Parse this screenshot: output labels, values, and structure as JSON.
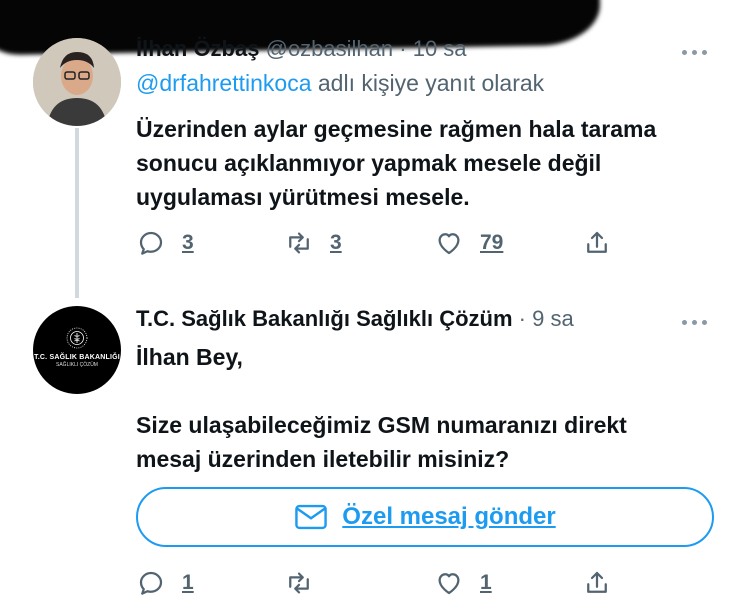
{
  "tweet1": {
    "author_name": "İlhan Özbaş",
    "author_handle": "@ozbasilhan",
    "time": "· 10 sa",
    "reply_prefix": "@drfahrettinkoca",
    "reply_suffix": " adlı kişiye yanıt olarak",
    "text_lines": [
      "Üzerinden aylar geçmesine rağmen hala tarama",
      "sonucu açıklanmıyor yapmak mesele değil",
      "uygulaması yürütmesi mesele."
    ],
    "reply_count": "3",
    "retweet_count": "3",
    "like_count": "79"
  },
  "tweet2": {
    "author_name": "T.C. Sağlık Bakanlığı Sağlıklı Çözüm",
    "time": "· 9 sa",
    "avatar_text_1": "T.C. SAĞLIK BAKANLIĞI",
    "avatar_text_2": "SAĞLIKLI ÇÖZÜM",
    "text_line_1": "İlhan Bey,",
    "text_line_2": "Size ulaşabileceğimiz GSM numaranızı direkt",
    "text_line_3": "mesaj üzerinden iletebilir misiniz?",
    "dm_button_label": "Özel mesaj gönder",
    "reply_count": "1",
    "like_count": "1"
  },
  "icons": [
    "reply-icon",
    "retweet-icon",
    "like-icon",
    "share-icon",
    "mail-icon",
    "more-icon"
  ],
  "colors": {
    "accent": "#1d9bf0",
    "muted": "#536471",
    "text": "#0f1419"
  }
}
